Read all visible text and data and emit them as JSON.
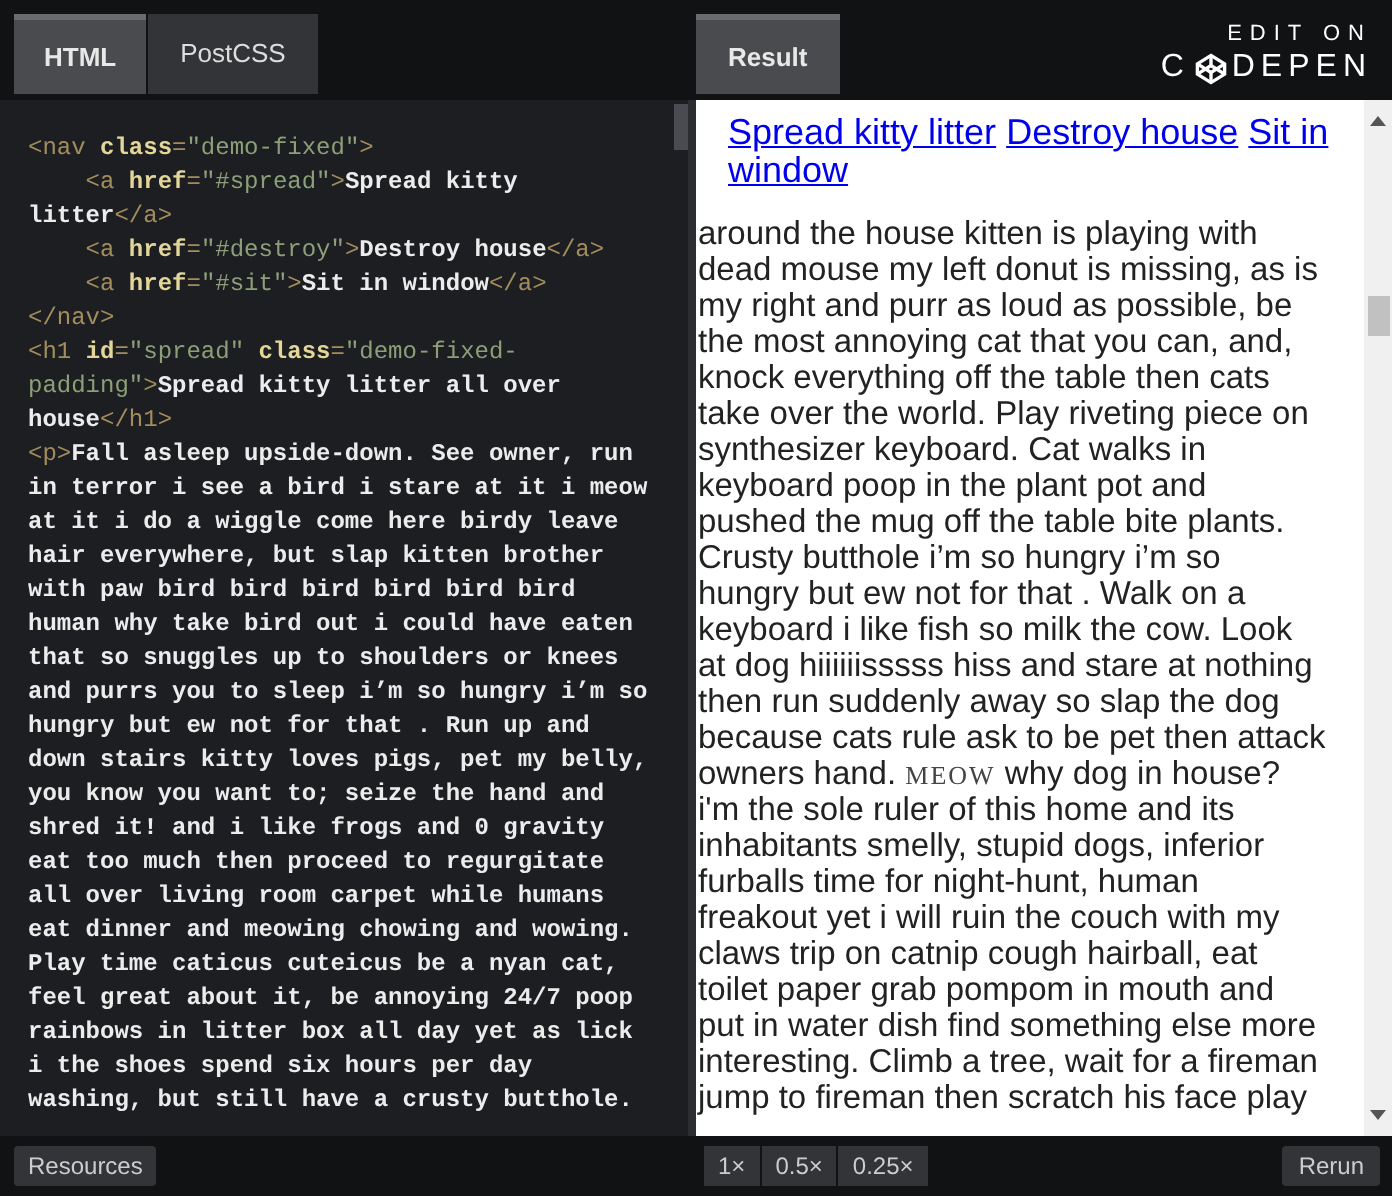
{
  "editor_tabs": [
    {
      "label": "HTML",
      "selected": true
    },
    {
      "label": "PostCSS",
      "selected": false
    }
  ],
  "code_lines": [
    [
      {
        "kind": "tag",
        "text": "<nav "
      },
      {
        "kind": "attr",
        "text": "class"
      },
      {
        "kind": "tag",
        "text": "="
      },
      {
        "kind": "value",
        "text": "\"demo-fixed\""
      },
      {
        "kind": "tag",
        "text": ">"
      }
    ],
    [
      {
        "kind": "tag",
        "text": "    <a "
      },
      {
        "kind": "attr",
        "text": "href"
      },
      {
        "kind": "tag",
        "text": "="
      },
      {
        "kind": "value",
        "text": "\"#spread\""
      },
      {
        "kind": "tag",
        "text": ">"
      },
      {
        "kind": "text",
        "text": "Spread kitty"
      }
    ],
    [
      {
        "kind": "text",
        "text": "litter"
      },
      {
        "kind": "tag",
        "text": "</a>"
      }
    ],
    [
      {
        "kind": "tag",
        "text": "    <a "
      },
      {
        "kind": "attr",
        "text": "href"
      },
      {
        "kind": "tag",
        "text": "="
      },
      {
        "kind": "value",
        "text": "\"#destroy\""
      },
      {
        "kind": "tag",
        "text": ">"
      },
      {
        "kind": "text",
        "text": "Destroy house"
      },
      {
        "kind": "tag",
        "text": "</a>"
      }
    ],
    [
      {
        "kind": "tag",
        "text": "    <a "
      },
      {
        "kind": "attr",
        "text": "href"
      },
      {
        "kind": "tag",
        "text": "="
      },
      {
        "kind": "value",
        "text": "\"#sit\""
      },
      {
        "kind": "tag",
        "text": ">"
      },
      {
        "kind": "text",
        "text": "Sit in window"
      },
      {
        "kind": "tag",
        "text": "</a>"
      }
    ],
    [
      {
        "kind": "tag",
        "text": "</nav>"
      }
    ],
    [
      {
        "kind": "tag",
        "text": "<h1 "
      },
      {
        "kind": "attr",
        "text": "id"
      },
      {
        "kind": "tag",
        "text": "="
      },
      {
        "kind": "value",
        "text": "\"spread\""
      },
      {
        "kind": "attr",
        "text": " class"
      },
      {
        "kind": "tag",
        "text": "="
      },
      {
        "kind": "value",
        "text": "\"demo-fixed-"
      }
    ],
    [
      {
        "kind": "value",
        "text": "padding\""
      },
      {
        "kind": "tag",
        "text": ">"
      },
      {
        "kind": "text",
        "text": "Spread kitty litter all over"
      }
    ],
    [
      {
        "kind": "text",
        "text": "house"
      },
      {
        "kind": "tag",
        "text": "</h1>"
      }
    ],
    [
      {
        "kind": "tag",
        "text": "<p>"
      },
      {
        "kind": "text",
        "text": "Fall asleep upside-down. See owner, run"
      }
    ],
    [
      {
        "kind": "text",
        "text": "in terror i see a bird i stare at it i meow"
      }
    ],
    [
      {
        "kind": "text",
        "text": "at it i do a wiggle come here birdy leave"
      }
    ],
    [
      {
        "kind": "text",
        "text": "hair everywhere, but slap kitten brother"
      }
    ],
    [
      {
        "kind": "text",
        "text": "with paw bird bird bird bird bird bird"
      }
    ],
    [
      {
        "kind": "text",
        "text": "human why take bird out i could have eaten"
      }
    ],
    [
      {
        "kind": "text",
        "text": "that so snuggles up to shoulders or knees"
      }
    ],
    [
      {
        "kind": "text",
        "text": "and purrs you to sleep i’m so hungry i’m so"
      }
    ],
    [
      {
        "kind": "text",
        "text": "hungry but ew not for that . Run up and"
      }
    ],
    [
      {
        "kind": "text",
        "text": "down stairs kitty loves pigs, pet my belly,"
      }
    ],
    [
      {
        "kind": "text",
        "text": "you know you want to; seize the hand and"
      }
    ],
    [
      {
        "kind": "text",
        "text": "shred it! and i like frogs and 0 gravity"
      }
    ],
    [
      {
        "kind": "text",
        "text": "eat too much then proceed to regurgitate"
      }
    ],
    [
      {
        "kind": "text",
        "text": "all over living room carpet while humans"
      }
    ],
    [
      {
        "kind": "text",
        "text": "eat dinner and meowing chowing and wowing."
      }
    ],
    [
      {
        "kind": "text",
        "text": "Play time caticus cuteicus be a nyan cat,"
      }
    ],
    [
      {
        "kind": "text",
        "text": "feel great about it, be annoying 24/7 poop"
      }
    ],
    [
      {
        "kind": "text",
        "text": "rainbows in litter box all day yet as lick"
      }
    ],
    [
      {
        "kind": "text",
        "text": "i the shoes spend six hours per day"
      }
    ],
    [
      {
        "kind": "text",
        "text": "washing, but still have a crusty butthole."
      }
    ]
  ],
  "result_tab": {
    "label": "Result",
    "selected": true
  },
  "logo": {
    "top": "EDIT ON",
    "left": "C",
    "right": "DEPEN"
  },
  "nav_links": [
    "Spread kitty litter",
    "Destroy house",
    "Sit in window"
  ],
  "result_lines": [
    "around the house kitten is playing with",
    "dead mouse my left donut is missing, as is",
    "my right and purr as loud as possible, be",
    "the most annoying cat that you can, and,",
    "knock everything off the table then cats",
    "take over the world. Play riveting piece on",
    "synthesizer keyboard. Cat walks in",
    "keyboard poop in the plant pot and",
    "pushed the mug off the table bite plants.",
    "Crusty butthole i’m so hungry i’m so",
    "hungry but ew not for that . Walk on a",
    "keyboard i like fish so milk the cow. Look",
    "at dog hiiiiiisssss hiss and stare at nothing",
    "then run suddenly away so slap the dog",
    "because cats rule ask to be pet then attack",
    [
      {
        "kind": "plain",
        "text": "owners hand. "
      },
      {
        "kind": "smallcaps",
        "text": "MEOW"
      },
      {
        "kind": "plain",
        "text": " why dog in house?"
      }
    ],
    "i'm the sole ruler of this home and its",
    "inhabitants smelly, stupid dogs, inferior",
    "furballs time for night-hunt, human",
    "freakout yet i will ruin the couch with my",
    "claws trip on catnip cough hairball, eat",
    "toilet paper grab pompom in mouth and",
    "put in water dish find something else more",
    "interesting. Climb a tree, wait for a fireman",
    "jump to fireman then scratch his face play"
  ],
  "footer": {
    "resources": "Resources",
    "zoom_buttons": [
      "1×",
      "0.5×",
      "0.25×"
    ],
    "rerun": "Rerun"
  }
}
